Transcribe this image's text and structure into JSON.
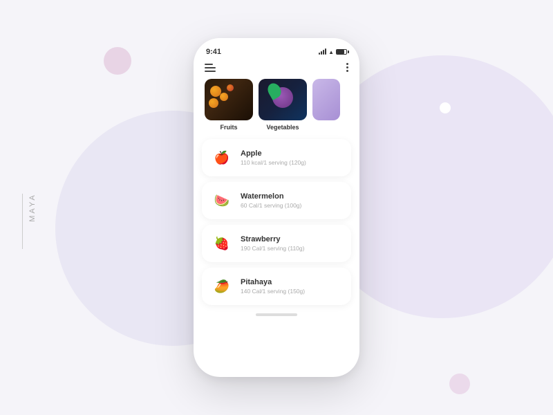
{
  "app": {
    "brand": "MAYA"
  },
  "phone": {
    "status_bar": {
      "time": "9:41"
    },
    "categories": [
      {
        "id": "fruits",
        "label": "Fruits",
        "type": "fruits"
      },
      {
        "id": "vegetables",
        "label": "Vegetables",
        "type": "vegetables"
      },
      {
        "id": "other",
        "label": "",
        "type": "purple"
      }
    ],
    "food_items": [
      {
        "name": "Apple",
        "calories": "110 kcal/1 serving (120g)",
        "emoji": "🍎"
      },
      {
        "name": "Watermelon",
        "calories": "60 Cal/1 serving (100g)",
        "emoji": "🍉"
      },
      {
        "name": "Strawberry",
        "calories": "190 Cal/1 serving (110g)",
        "emoji": "🍓"
      },
      {
        "name": "Pitahaya",
        "calories": "140 Cal/1 serving (150g)",
        "emoji": "🥭"
      }
    ]
  }
}
